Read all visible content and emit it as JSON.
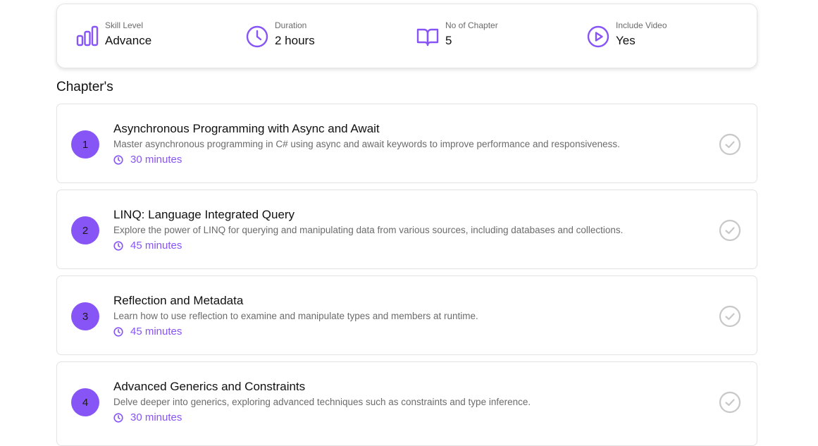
{
  "stats": [
    {
      "icon": "bar-chart-icon",
      "label": "Skill Level",
      "value": "Advance"
    },
    {
      "icon": "clock-icon",
      "label": "Duration",
      "value": "2 hours"
    },
    {
      "icon": "book-icon",
      "label": "No of Chapter",
      "value": "5"
    },
    {
      "icon": "play-circle-icon",
      "label": "Include Video",
      "value": "Yes"
    }
  ],
  "section_title": "Chapter's",
  "chapters": [
    {
      "number": "1",
      "title": "Asynchronous Programming with Async and Await",
      "description": "Master asynchronous programming in C# using async and await keywords to improve performance and responsiveness.",
      "duration": "30 minutes"
    },
    {
      "number": "2",
      "title": "LINQ: Language Integrated Query",
      "description": "Explore the power of LINQ for querying and manipulating data from various sources, including databases and collections.",
      "duration": "45 minutes"
    },
    {
      "number": "3",
      "title": "Reflection and Metadata",
      "description": "Learn how to use reflection to examine and manipulate types and members at runtime.",
      "duration": "45 minutes"
    },
    {
      "number": "4",
      "title": "Advanced Generics and Constraints",
      "description": "Delve deeper into generics, exploring advanced techniques such as constraints and type inference.",
      "duration": "30 minutes"
    }
  ],
  "colors": {
    "accent": "#8754f5",
    "muted_text": "#6b6b6b",
    "check": "#c8c8c8"
  }
}
